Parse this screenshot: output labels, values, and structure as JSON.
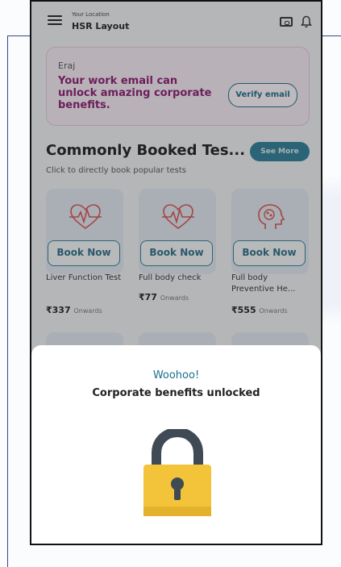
{
  "header": {
    "location_caption": "Your Location",
    "location_value": "HSR Layout"
  },
  "verify_card": {
    "name": "Eraj",
    "promo_text": "Your work email can unlock amazing corporate benefits.",
    "verify_button": "Verify email"
  },
  "section": {
    "title": "Commonly Booked Tes...",
    "subtitle": "Click to directly book popular tests",
    "see_more": "See More"
  },
  "tests": [
    {
      "button": "Book Now",
      "name": "Liver Function Test",
      "price": "₹337",
      "suffix": "Onwards",
      "icon": "heartbeat-icon"
    },
    {
      "button": "Book Now",
      "name": "Full body check",
      "price": "₹77",
      "suffix": "Onwards",
      "icon": "heartbeat-icon"
    },
    {
      "button": "Book Now",
      "name": "Full body Preventive He...",
      "price": "₹555",
      "suffix": "Onwards",
      "icon": "head-brain-icon"
    }
  ],
  "sheet": {
    "heading": "Woohoo!",
    "message": "Corporate benefits unlocked",
    "icon": "lock-icon"
  },
  "colors": {
    "accent": "#1a6e8f",
    "promo": "#8c1b72",
    "lock_body": "#f3c43a",
    "lock_shackle": "#3f4a55"
  }
}
